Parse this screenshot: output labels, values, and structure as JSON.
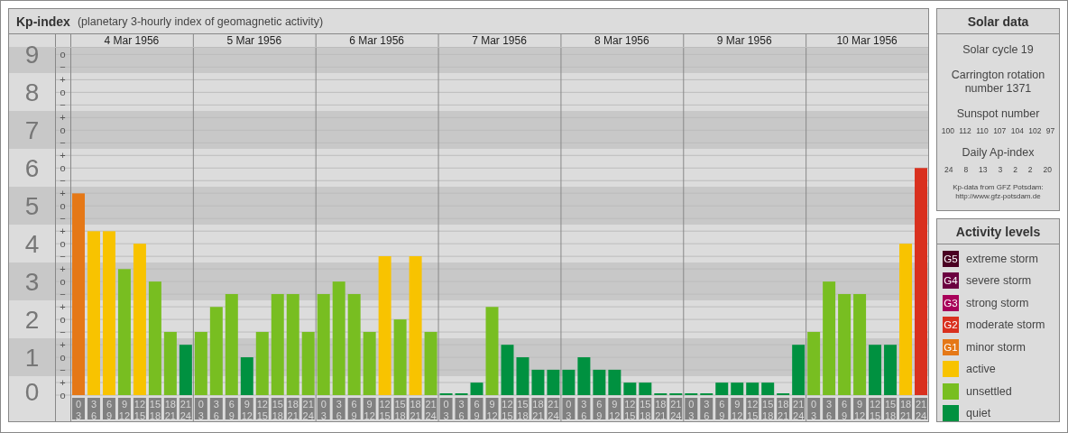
{
  "header": {
    "title": "Kp-index",
    "subtitle": "(planetary 3-hourly index of geomagnetic activity)"
  },
  "chart": {
    "days": [
      "4 Mar 1956",
      "5 Mar 1956",
      "6 Mar 1956",
      "7 Mar 1956",
      "8 Mar 1956",
      "9 Mar 1956",
      "10 Mar 1956"
    ],
    "minor_marks": [
      "o",
      "−",
      "+",
      "o",
      "−",
      "+",
      "o",
      "−",
      "+",
      "o",
      "−",
      "+",
      "o",
      "−",
      "+",
      "o",
      "−",
      "+",
      "o",
      "−",
      "+",
      "o",
      "−",
      "+",
      "o",
      "−",
      "+",
      "o"
    ],
    "chart_data": {
      "type": "bar",
      "ylim": [
        0,
        9.2
      ],
      "grid": true,
      "yticks": [
        0,
        1,
        2,
        3,
        4,
        5,
        6,
        7,
        8,
        9
      ],
      "categories": [
        "0\n3",
        "3\n6",
        "6\n9",
        "9\n12",
        "12\n15",
        "15\n18",
        "18\n21",
        "21\n24",
        "0\n3",
        "3\n6",
        "6\n9",
        "9\n12",
        "12\n15",
        "15\n18",
        "18\n21",
        "21\n24",
        "0\n3",
        "3\n6",
        "6\n9",
        "9\n12",
        "12\n15",
        "15\n18",
        "18\n21",
        "21\n24",
        "0\n3",
        "3\n6",
        "6\n9",
        "9\n12",
        "12\n15",
        "15\n18",
        "18\n21",
        "21\n24",
        "0\n3",
        "3\n6",
        "6\n9",
        "9\n12",
        "12\n15",
        "15\n18",
        "18\n21",
        "21\n24",
        "0\n3",
        "3\n6",
        "6\n9",
        "9\n12",
        "12\n15",
        "15\n18",
        "18\n21",
        "21\n24",
        "0\n3",
        "3\n6",
        "6\n9",
        "9\n12",
        "12\n15",
        "15\n18",
        "18\n21",
        "21\n24"
      ],
      "series": [
        {
          "color": "#009140",
          "values": [
            null,
            null,
            null,
            null,
            null,
            null,
            null,
            1.33,
            null,
            null,
            null,
            1,
            null,
            null,
            null,
            null,
            null,
            null,
            null,
            null,
            null,
            null,
            null,
            null,
            0,
            0,
            0.33,
            null,
            1.33,
            1,
            0.67,
            0.67,
            0.67,
            1,
            0.67,
            0.67,
            0.33,
            0.33,
            0,
            0,
            0,
            0,
            0.33,
            0.33,
            0.33,
            0.33,
            0,
            1.33,
            null,
            null,
            null,
            null,
            1.33,
            1.33,
            null,
            null
          ]
        },
        {
          "color": "#78be21",
          "values": [
            null,
            null,
            null,
            3.33,
            null,
            3,
            1.67,
            null,
            1.67,
            2.33,
            2.67,
            null,
            1.67,
            2.67,
            2.67,
            1.67,
            2.67,
            3,
            2.67,
            1.67,
            null,
            2,
            null,
            1.67,
            null,
            null,
            null,
            2.33,
            null,
            null,
            null,
            null,
            null,
            null,
            null,
            null,
            null,
            null,
            null,
            null,
            null,
            null,
            null,
            null,
            null,
            null,
            null,
            null,
            1.67,
            3,
            2.67,
            2.67,
            null,
            null,
            null,
            null
          ]
        },
        {
          "color": "#f8c300",
          "values": [
            null,
            4.33,
            4.33,
            null,
            4,
            null,
            null,
            null,
            null,
            null,
            null,
            null,
            null,
            null,
            null,
            null,
            null,
            null,
            null,
            null,
            3.67,
            null,
            3.67,
            null,
            null,
            null,
            null,
            null,
            null,
            null,
            null,
            null,
            null,
            null,
            null,
            null,
            null,
            null,
            null,
            null,
            null,
            null,
            null,
            null,
            null,
            null,
            null,
            null,
            null,
            null,
            null,
            null,
            null,
            null,
            4,
            null
          ]
        },
        {
          "color": "#e57817",
          "values": [
            5.33,
            null,
            null,
            null,
            null,
            null,
            null,
            null,
            null,
            null,
            null,
            null,
            null,
            null,
            null,
            null,
            null,
            null,
            null,
            null,
            null,
            null,
            null,
            null,
            null,
            null,
            null,
            null,
            null,
            null,
            null,
            null,
            null,
            null,
            null,
            null,
            null,
            null,
            null,
            null,
            null,
            null,
            null,
            null,
            null,
            null,
            null,
            null,
            null,
            null,
            null,
            null,
            null,
            null,
            null,
            null
          ]
        },
        {
          "color": "#d9301e",
          "values": [
            null,
            null,
            null,
            null,
            null,
            null,
            null,
            null,
            null,
            null,
            null,
            null,
            null,
            null,
            null,
            null,
            null,
            null,
            null,
            null,
            null,
            null,
            null,
            null,
            null,
            null,
            null,
            null,
            null,
            null,
            null,
            null,
            null,
            null,
            null,
            null,
            null,
            null,
            null,
            null,
            null,
            null,
            null,
            null,
            null,
            null,
            null,
            null,
            null,
            null,
            null,
            null,
            null,
            null,
            null,
            6
          ]
        }
      ]
    }
  },
  "solar_data": {
    "title": "Solar data",
    "solar_cycle": "Solar cycle 19",
    "carrington": "Carrington rotation number 1371",
    "sunspot_heading": "Sunspot number",
    "sunspot_numbers": [
      "100",
      "112",
      "110",
      "107",
      "104",
      "102",
      "97"
    ],
    "ap_heading": "Daily Ap-index",
    "ap_values": [
      "24",
      "8",
      "13",
      "3",
      "2",
      "2",
      "20"
    ],
    "source_lines": [
      "Kp-data from GFZ Potsdam:",
      "http://www.gfz-potsdam.de"
    ]
  },
  "activity_levels": {
    "title": "Activity levels",
    "items": [
      {
        "kind": "g-scale",
        "badge": "G5",
        "label": "extreme storm",
        "color": "#4a0022"
      },
      {
        "kind": "g-scale",
        "badge": "G4",
        "label": "severe storm",
        "color": "#6b0040"
      },
      {
        "kind": "g-scale",
        "badge": "G3",
        "label": "strong storm",
        "color": "#a8005a"
      },
      {
        "kind": "g-scale",
        "badge": "G2",
        "label": "moderate storm",
        "color": "#d9301e"
      },
      {
        "kind": "g-scale",
        "badge": "G1",
        "label": "minor storm",
        "color": "#e57817"
      },
      {
        "kind": "level",
        "label": "active",
        "color": "#f8c300"
      },
      {
        "kind": "level",
        "label": "unsettled",
        "color": "#78be21"
      },
      {
        "kind": "level",
        "label": "quiet",
        "color": "#009140"
      }
    ]
  }
}
